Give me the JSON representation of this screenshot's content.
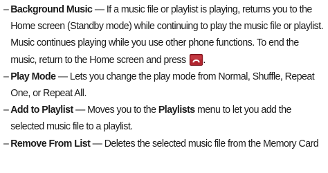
{
  "items": [
    {
      "dash": "–",
      "term": "Background Music",
      "sep": " — ",
      "desc": "If a music file or playlist is playing, returns you to the Home screen (Standby mode) while continuing to play the music file or playlist. Music continues playing while you use other phone functions. To end the music, return to the Home screen and press ",
      "tail": "."
    },
    {
      "dash": "–",
      "term": "Play Mode",
      "sep": " — ",
      "desc": "Lets you change the play mode from Normal, Shuffle, Repeat One, or Repeat All."
    },
    {
      "dash": "–",
      "term": "Add to Playlist",
      "sep": " — ",
      "desc": "Moves you to the ",
      "term2": "Playlists",
      "desc2": " menu to let you add the selected music file to a playlist."
    },
    {
      "dash": "–",
      "term": "Remove From List",
      "sep": " — ",
      "desc": "Deletes the selected music file from the Memory Card"
    }
  ],
  "icons": {
    "end_key": "end-key-icon",
    "end_key_color": "#b0252f"
  }
}
